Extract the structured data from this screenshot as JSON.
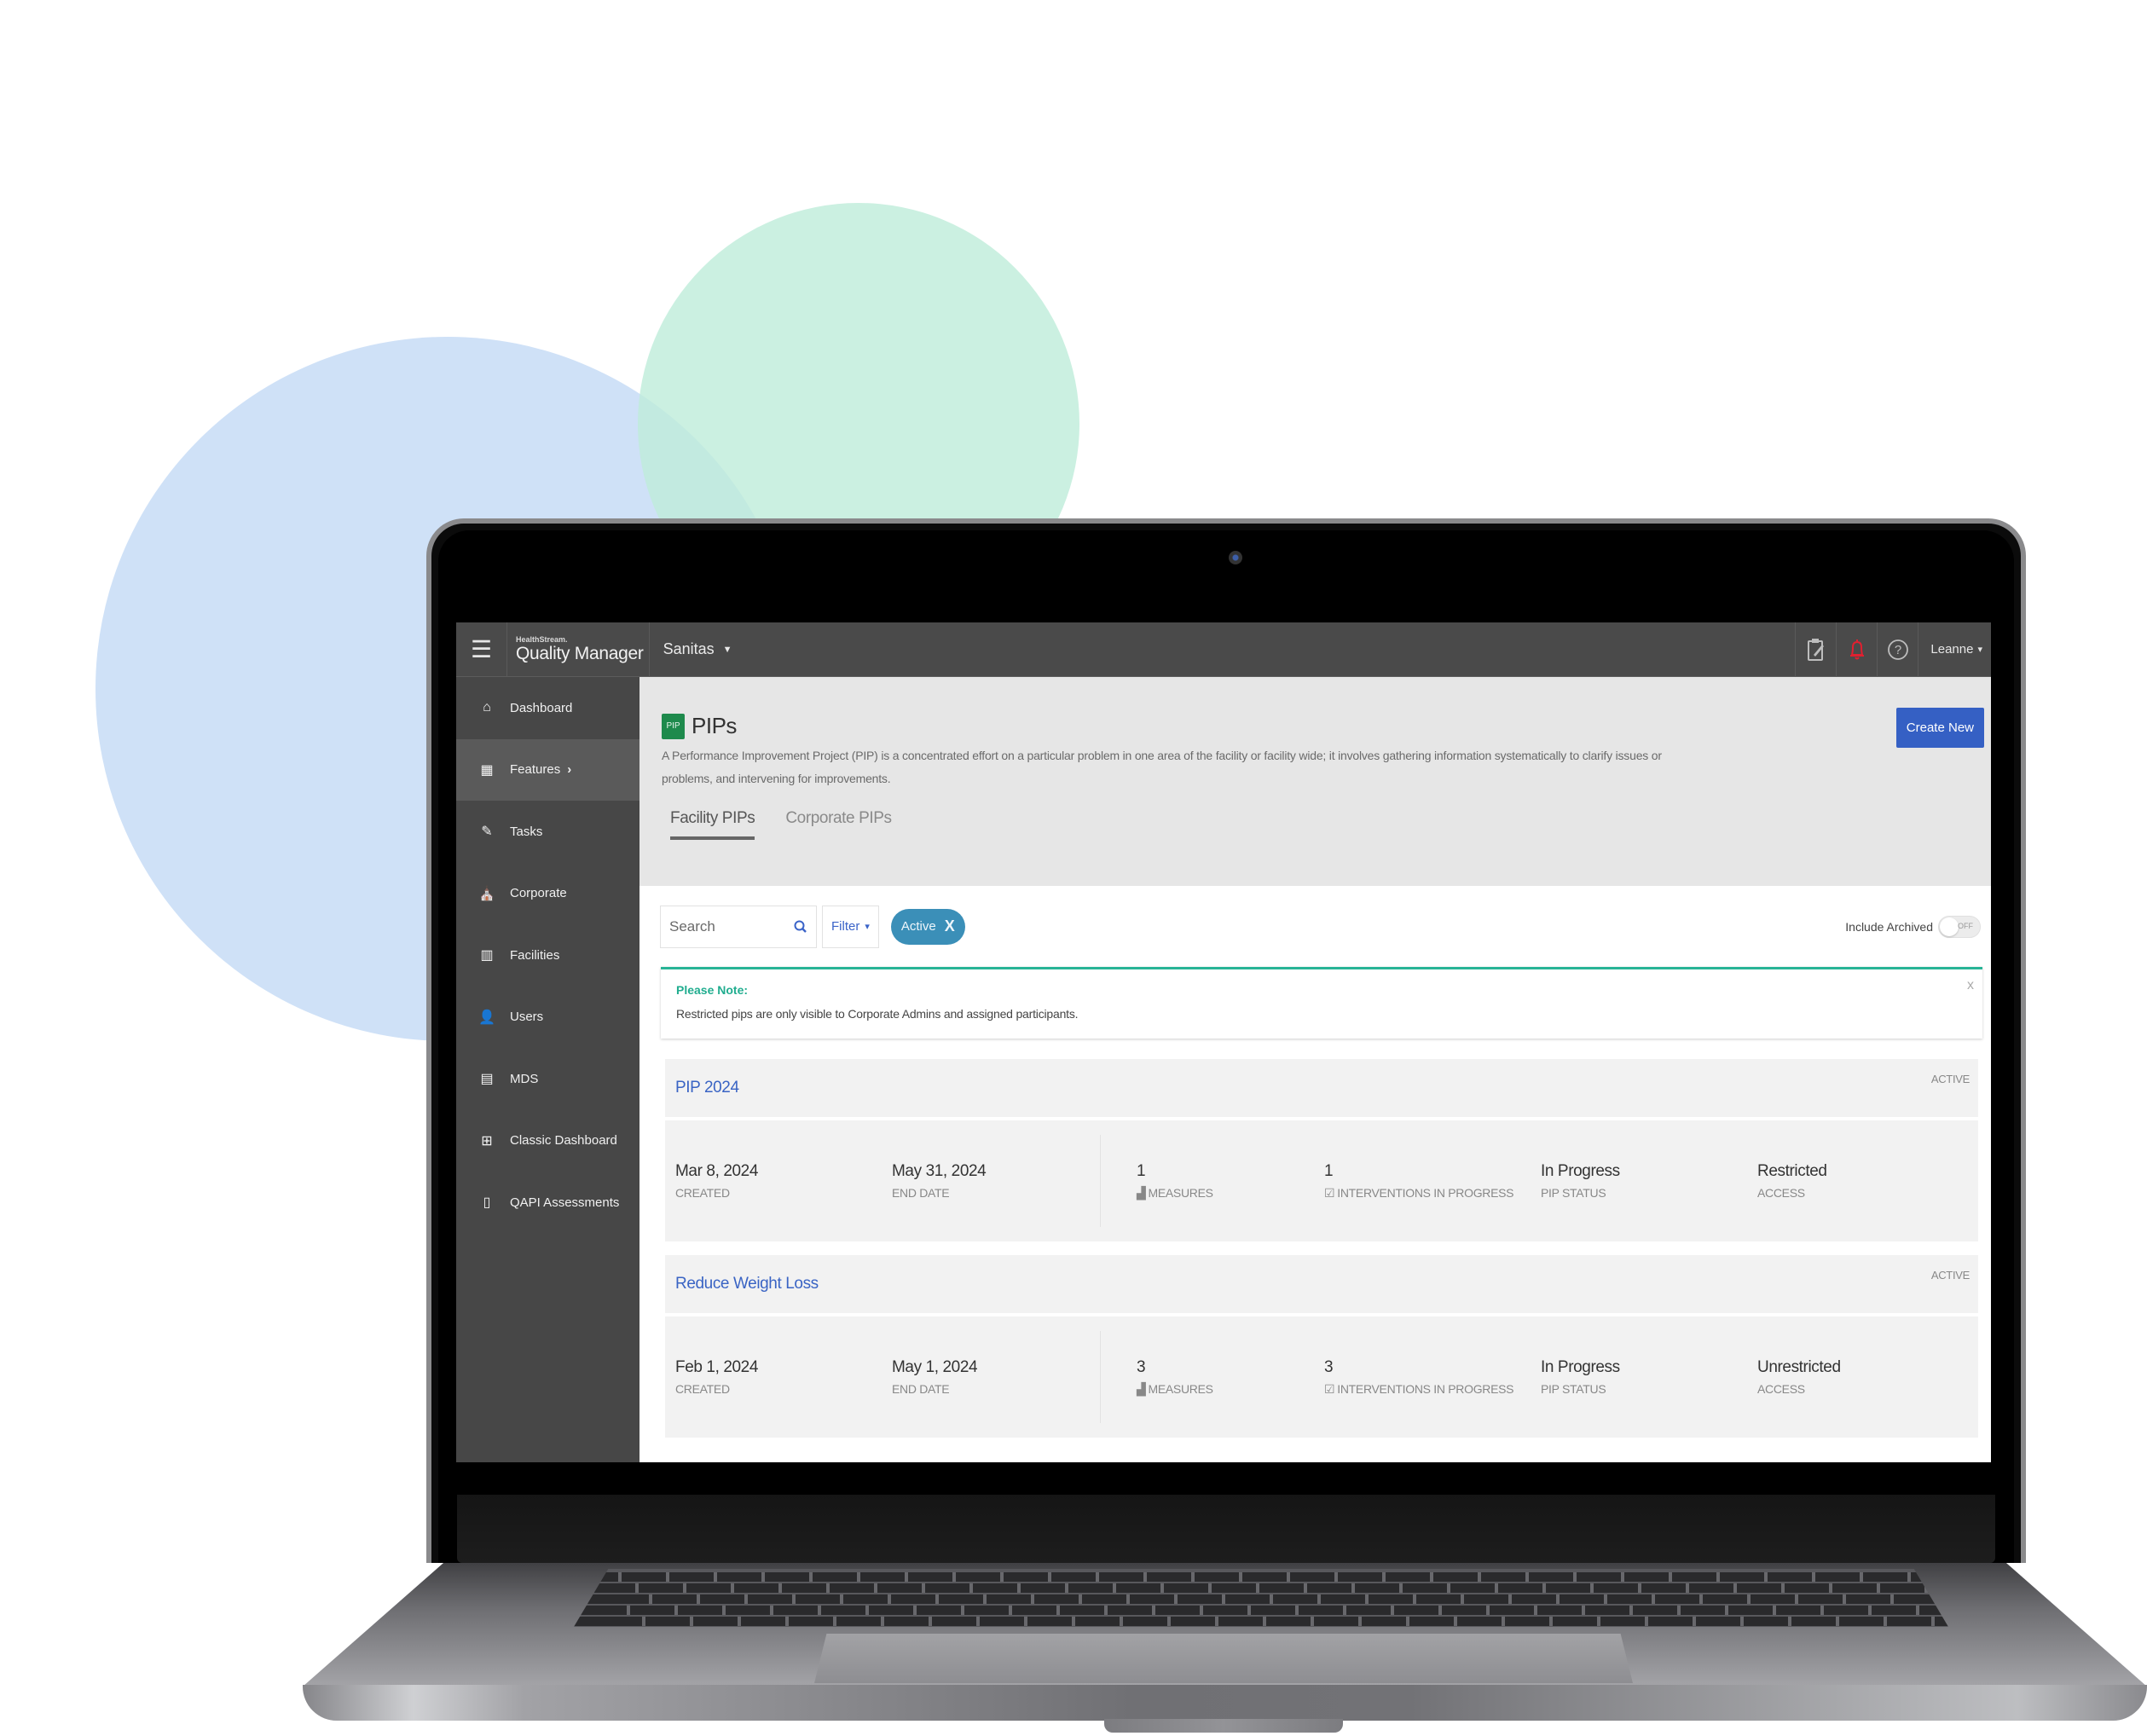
{
  "app": {
    "brand_small": "HealthStream.",
    "brand_name": "Quality Manager",
    "facility": "Sanitas",
    "user": "Leanne"
  },
  "topbar_icons": [
    "clipboard-icon",
    "bell-icon",
    "help-icon"
  ],
  "colors": {
    "primary": "#3560c4",
    "link": "#3a64c4",
    "note_accent": "#28b496",
    "chip": "#3b8fb8",
    "pip_badge": "#1e8a4c",
    "alert_bell": "#e02030"
  },
  "sidebar": {
    "items": [
      {
        "label": "Dashboard",
        "icon": "home-icon"
      },
      {
        "label": "Features",
        "icon": "grid-icon",
        "active": true,
        "chevron": "›"
      },
      {
        "label": "Tasks",
        "icon": "pen-icon"
      },
      {
        "label": "Corporate",
        "icon": "capitol-icon"
      },
      {
        "label": "Facilities",
        "icon": "building-icon"
      },
      {
        "label": "Users",
        "icon": "user-icon"
      },
      {
        "label": "MDS",
        "icon": "mds-icon"
      },
      {
        "label": "Classic Dashboard",
        "icon": "dashboard-grid-icon"
      },
      {
        "label": "QAPI Assessments",
        "icon": "qa-doc-icon"
      }
    ]
  },
  "header": {
    "badge": "PIP",
    "title": "PIPs",
    "description": "A Performance Improvement Project (PIP) is a concentrated effort on a particular problem in one area of the facility or facility wide; it involves gathering information systematically to clarify issues or problems, and intervening for improvements.",
    "create_label": "Create New",
    "tabs": [
      {
        "label": "Facility PIPs",
        "active": true
      },
      {
        "label": "Corporate PIPs",
        "active": false
      }
    ]
  },
  "toolbar": {
    "search_placeholder": "Search",
    "filter_label": "Filter",
    "active_chip": "Active",
    "chip_remove": "X",
    "include_archived_label": "Include Archived",
    "toggle_state": "OFF"
  },
  "note": {
    "title": "Please Note:",
    "text": "Restricted pips are only visible to Corporate Admins and assigned participants.",
    "close": "x"
  },
  "pips": [
    {
      "title": "PIP 2024",
      "status": "ACTIVE",
      "created": "Mar 8, 2024",
      "created_label": "CREATED",
      "end_date": "May 31, 2024",
      "end_date_label": "END DATE",
      "measures": "1",
      "measures_label": "MEASURES",
      "interventions": "1",
      "interventions_label": "INTERVENTIONS IN PROGRESS",
      "pip_status": "In Progress",
      "pip_status_label": "PIP STATUS",
      "access": "Restricted",
      "access_label": "ACCESS"
    },
    {
      "title": "Reduce Weight Loss",
      "status": "ACTIVE",
      "created": "Feb 1, 2024",
      "created_label": "CREATED",
      "end_date": "May 1, 2024",
      "end_date_label": "END DATE",
      "measures": "3",
      "measures_label": "MEASURES",
      "interventions": "3",
      "interventions_label": "INTERVENTIONS IN PROGRESS",
      "pip_status": "In Progress",
      "pip_status_label": "PIP STATUS",
      "access": "Unrestricted",
      "access_label": "ACCESS"
    }
  ]
}
